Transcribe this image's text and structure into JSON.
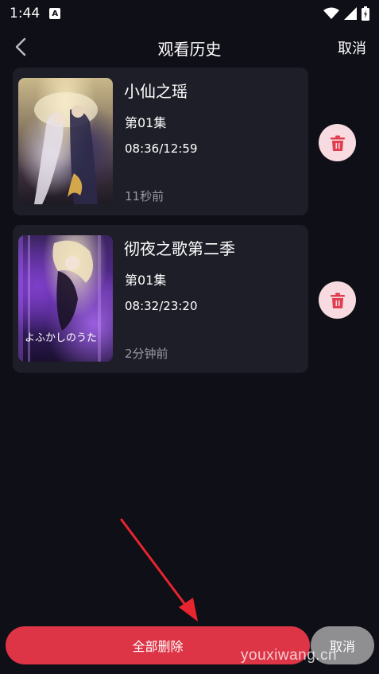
{
  "status": {
    "time": "1:44",
    "notification_icon": "A"
  },
  "nav": {
    "title": "观看历史",
    "cancel": "取消"
  },
  "history": [
    {
      "title": "小仙之瑶",
      "episode": "第01集",
      "progress": "08:36/12:59",
      "ago": "11秒前",
      "poster_text": ""
    },
    {
      "title": "彻夜之歌第二季",
      "episode": "第01集",
      "progress": "08:32/23:20",
      "ago": "2分钟前",
      "poster_text": "よふかしのうた"
    }
  ],
  "actions": {
    "delete_all": "全部删除",
    "cancel": "取消"
  },
  "watermark": "youxiwang.cn",
  "colors": {
    "background": "#0f0f17",
    "card": "#1d1e27",
    "accent": "#dd3446",
    "delete_bg": "#f7dbe0"
  },
  "icons": [
    "back-chevron-icon",
    "trash-icon",
    "wifi-icon",
    "signal-icon",
    "battery-icon"
  ]
}
